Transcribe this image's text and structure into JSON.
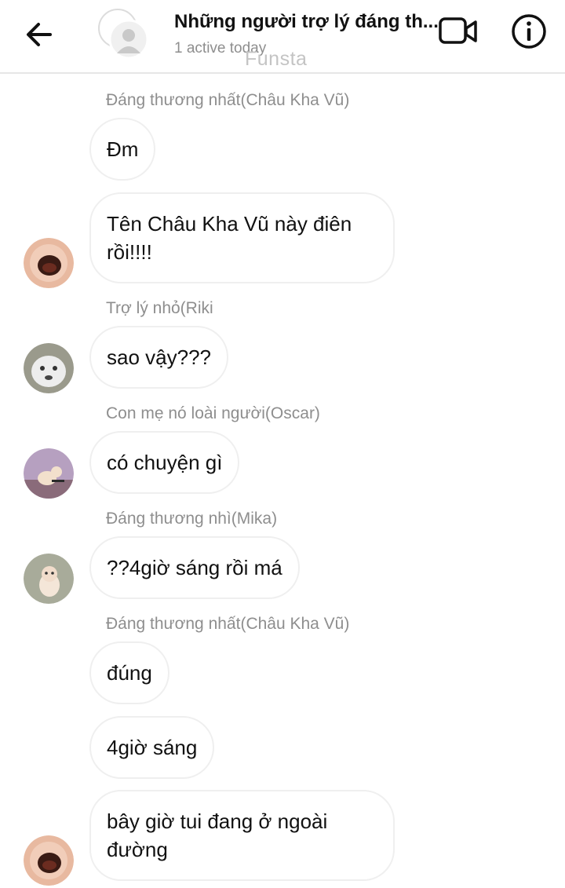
{
  "header": {
    "title": "Những người trợ lý đáng th...",
    "status": "1 active today",
    "watermark": "Funsta"
  },
  "messages": [
    {
      "sender": "Đáng thương nhất(Châu Kha Vũ)",
      "text": "Đm"
    },
    {
      "text": "Tên Châu Kha Vũ này điên rồi!!!!"
    },
    {
      "sender": "Trợ lý nhỏ(Riki",
      "text": "sao vậy???"
    },
    {
      "sender": "Con mẹ nó loài người(Oscar)",
      "text": "có chuyện gì"
    },
    {
      "sender": "Đáng thương nhì(Mika)",
      "text": "??4giờ sáng rồi má"
    },
    {
      "sender": "Đáng thương nhất(Châu Kha Vũ)",
      "text": "đúng"
    },
    {
      "text": "4giờ sáng"
    },
    {
      "text": "bây giờ tui đang ở ngoài đường"
    }
  ]
}
